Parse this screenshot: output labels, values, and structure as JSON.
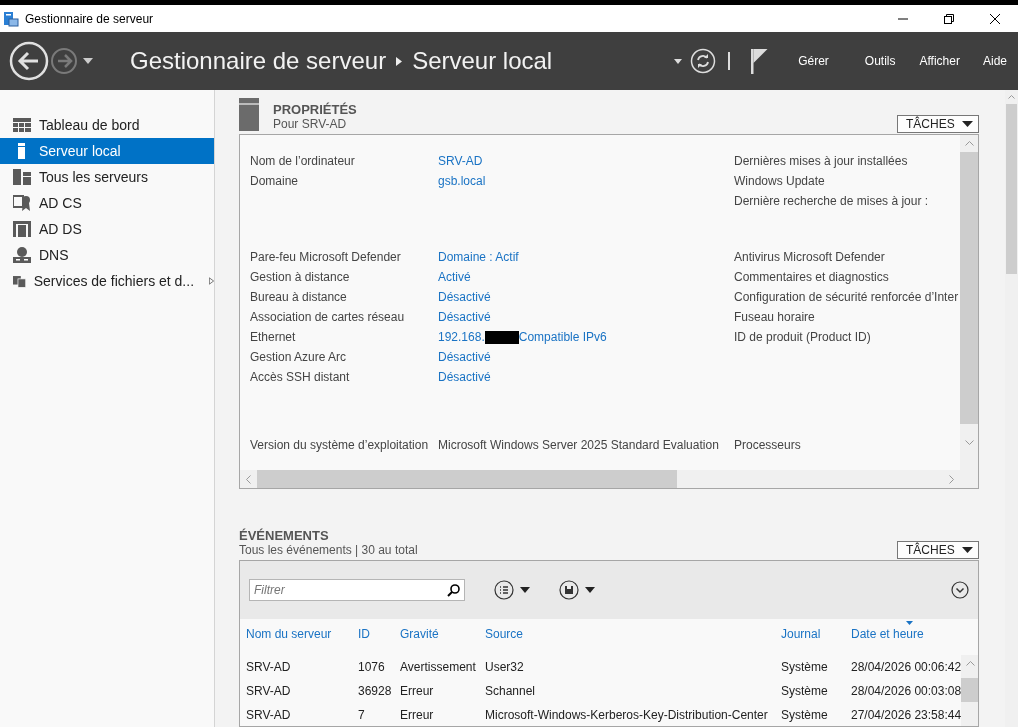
{
  "window": {
    "title": "Gestionnaire de serveur"
  },
  "header": {
    "breadcrumb": [
      "Gestionnaire de serveur",
      "Serveur local"
    ],
    "menus": [
      "Gérer",
      "Outils",
      "Afficher",
      "Aide"
    ]
  },
  "sidebar": {
    "items": [
      {
        "label": "Tableau de bord",
        "selected": false,
        "expandable": false
      },
      {
        "label": "Serveur local",
        "selected": true,
        "expandable": false
      },
      {
        "label": "Tous les serveurs",
        "selected": false,
        "expandable": false
      },
      {
        "label": "AD CS",
        "selected": false,
        "expandable": false
      },
      {
        "label": "AD DS",
        "selected": false,
        "expandable": false
      },
      {
        "label": "DNS",
        "selected": false,
        "expandable": false
      },
      {
        "label": "Services de fichiers et d...",
        "selected": false,
        "expandable": true
      }
    ]
  },
  "properties": {
    "title": "PROPRIÉTÉS",
    "subtitle": "Pour SRV-AD",
    "tasks_button": "TÂCHES",
    "groups": [
      {
        "rows": [
          {
            "label": "Nom de l’ordinateur",
            "value": "SRV-AD",
            "link": true,
            "right": "Dernières mises à jour installées"
          },
          {
            "label": "Domaine",
            "value": "gsb.local",
            "link": true,
            "right": "Windows Update"
          },
          {
            "right": "Dernière recherche de mises à jour :"
          }
        ]
      },
      {
        "rows": [
          {
            "label": "Pare-feu Microsoft Defender",
            "value": "Domaine : Actif",
            "link": true,
            "right": "Antivirus Microsoft Defender"
          },
          {
            "label": "Gestion à distance",
            "value": "Activé",
            "link": true,
            "right": "Commentaires et diagnostics"
          },
          {
            "label": "Bureau à distance",
            "value": "Désactivé",
            "link": true,
            "right": "Configuration de sécurité renforcée d’Inter"
          },
          {
            "label": "Association de cartes réseau",
            "value": "Désactivé",
            "link": true,
            "right": "Fuseau horaire"
          },
          {
            "label": "Ethernet",
            "value": "192.168.",
            "redacted": true,
            "value_suffix": "Compatible IPv6",
            "link": true,
            "right": "ID de produit (Product ID)"
          },
          {
            "label": "Gestion Azure Arc",
            "value": "Désactivé",
            "link": true
          },
          {
            "label": "Accès SSH distant",
            "value": "Désactivé",
            "link": true
          }
        ]
      },
      {
        "rows": [
          {
            "label": "Version du système d’exploitation",
            "value": "Microsoft Windows Server 2025 Standard Evaluation",
            "link": false,
            "right": "Processeurs"
          }
        ]
      }
    ]
  },
  "events": {
    "title": "ÉVÉNEMENTS",
    "subtitle": "Tous les événements | 30 au total",
    "tasks_button": "TÂCHES",
    "filter": {
      "placeholder": "Filtrer"
    },
    "columns": [
      {
        "label": "Nom du serveur",
        "sorted": false
      },
      {
        "label": "ID",
        "sorted": false
      },
      {
        "label": "Gravité",
        "sorted": false
      },
      {
        "label": "Source",
        "sorted": false
      },
      {
        "label": "Journal",
        "sorted": false
      },
      {
        "label": "Date et heure",
        "sorted": true
      }
    ],
    "rows": [
      [
        "SRV-AD",
        "1076",
        "Avertissement",
        "User32",
        "Système",
        "28/04/2026 00:06:42"
      ],
      [
        "SRV-AD",
        "36928",
        "Erreur",
        "Schannel",
        "Système",
        "28/04/2026 00:03:08"
      ],
      [
        "SRV-AD",
        "7",
        "Erreur",
        "Microsoft-Windows-Kerberos-Key-Distribution-Center",
        "Système",
        "27/04/2026 23:58:44"
      ]
    ]
  }
}
